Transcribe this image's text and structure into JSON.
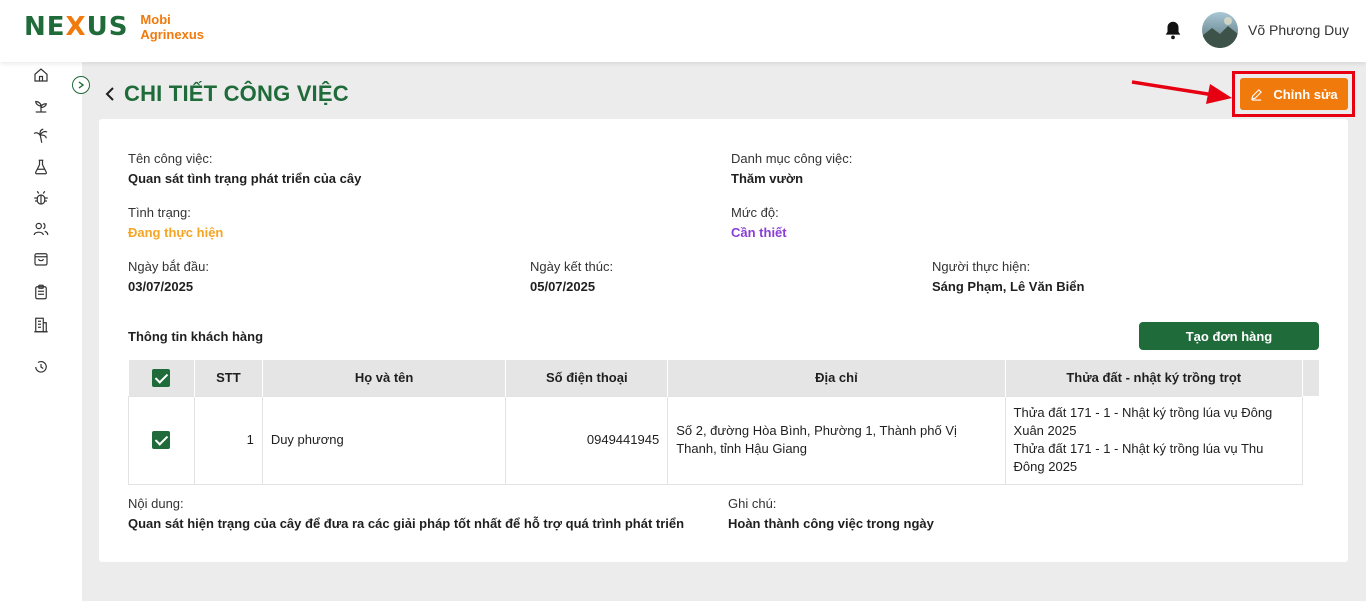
{
  "brand": {
    "logo_left": "NE",
    "logo_x": "X",
    "logo_right": "US",
    "name_line1": "Mobi",
    "name_line2": "Agrinexus"
  },
  "user": {
    "name": "Võ Phương Duy"
  },
  "page": {
    "title": "CHI TIẾT CÔNG VIỆC",
    "edit_label": "Chỉnh sửa"
  },
  "task": {
    "name_label": "Tên công việc:",
    "name": "Quan sát tình trạng phát triển của cây",
    "category_label": "Danh mục công việc:",
    "category": "Thăm vườn",
    "status_label": "Tình trạng:",
    "status": "Đang thực hiện",
    "priority_label": "Mức độ:",
    "priority": "Cần thiết",
    "start_label": "Ngày bắt đầu:",
    "start": "03/07/2025",
    "end_label": "Ngày kết thúc:",
    "end": "05/07/2025",
    "assignee_label": "Người thực hiện:",
    "assignee": "Sáng Phạm, Lê Văn Biển",
    "content_label": "Nội dung:",
    "content": "Quan sát hiện trạng của cây để đưa ra các giải pháp tốt nhất để hỗ trợ quá trình phát triển",
    "note_label": "Ghi chú:",
    "note": "Hoàn thành công việc trong ngày"
  },
  "customers": {
    "section_title": "Thông tin khách hàng",
    "create_order_label": "Tạo đơn hàng",
    "columns": [
      "STT",
      "Họ và tên",
      "Số điện thoại",
      "Địa chỉ",
      "Thửa đất - nhật ký trồng trọt"
    ],
    "rows": [
      {
        "stt": "1",
        "name": "Duy phương",
        "phone": "0949441945",
        "address": "Số 2, đường Hòa Bình, Phường 1, Thành phố Vị Thanh, tỉnh Hậu Giang",
        "plot1": "Thửa đất 171 - 1 - Nhật ký trồng lúa vụ Đông Xuân 2025",
        "plot2": "Thửa đất 171 - 1 - Nhật ký trồng lúa vụ Thu Đông 2025"
      }
    ]
  },
  "colors": {
    "green": "#1f6b3a",
    "orange": "#f07a0c",
    "red": "#e60012",
    "purple": "#8a3ed6",
    "status_orange": "#f5a524"
  }
}
